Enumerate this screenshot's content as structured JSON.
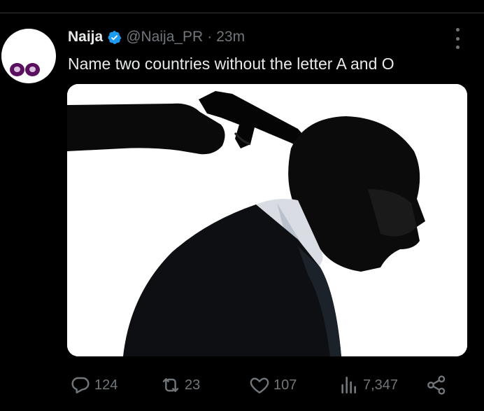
{
  "tweet": {
    "author": {
      "display_name": "Naija",
      "handle": "@Naija_PR",
      "verified": true,
      "avatar_icon": "naija-eyes-logo"
    },
    "separator": "·",
    "timestamp": "23m",
    "text": "Name two countries without the letter A and O",
    "media": {
      "description_icon": "silhouette-man-gun-to-head-image"
    }
  },
  "actions": {
    "reply_count": "124",
    "retweet_count": "23",
    "like_count": "107",
    "views_count": "7,347"
  },
  "colors": {
    "background": "#000000",
    "text": "#e7e9ea",
    "muted": "#71767b",
    "verified": "#1d9bf0",
    "avatar_eyes": "#5b0f5f"
  }
}
